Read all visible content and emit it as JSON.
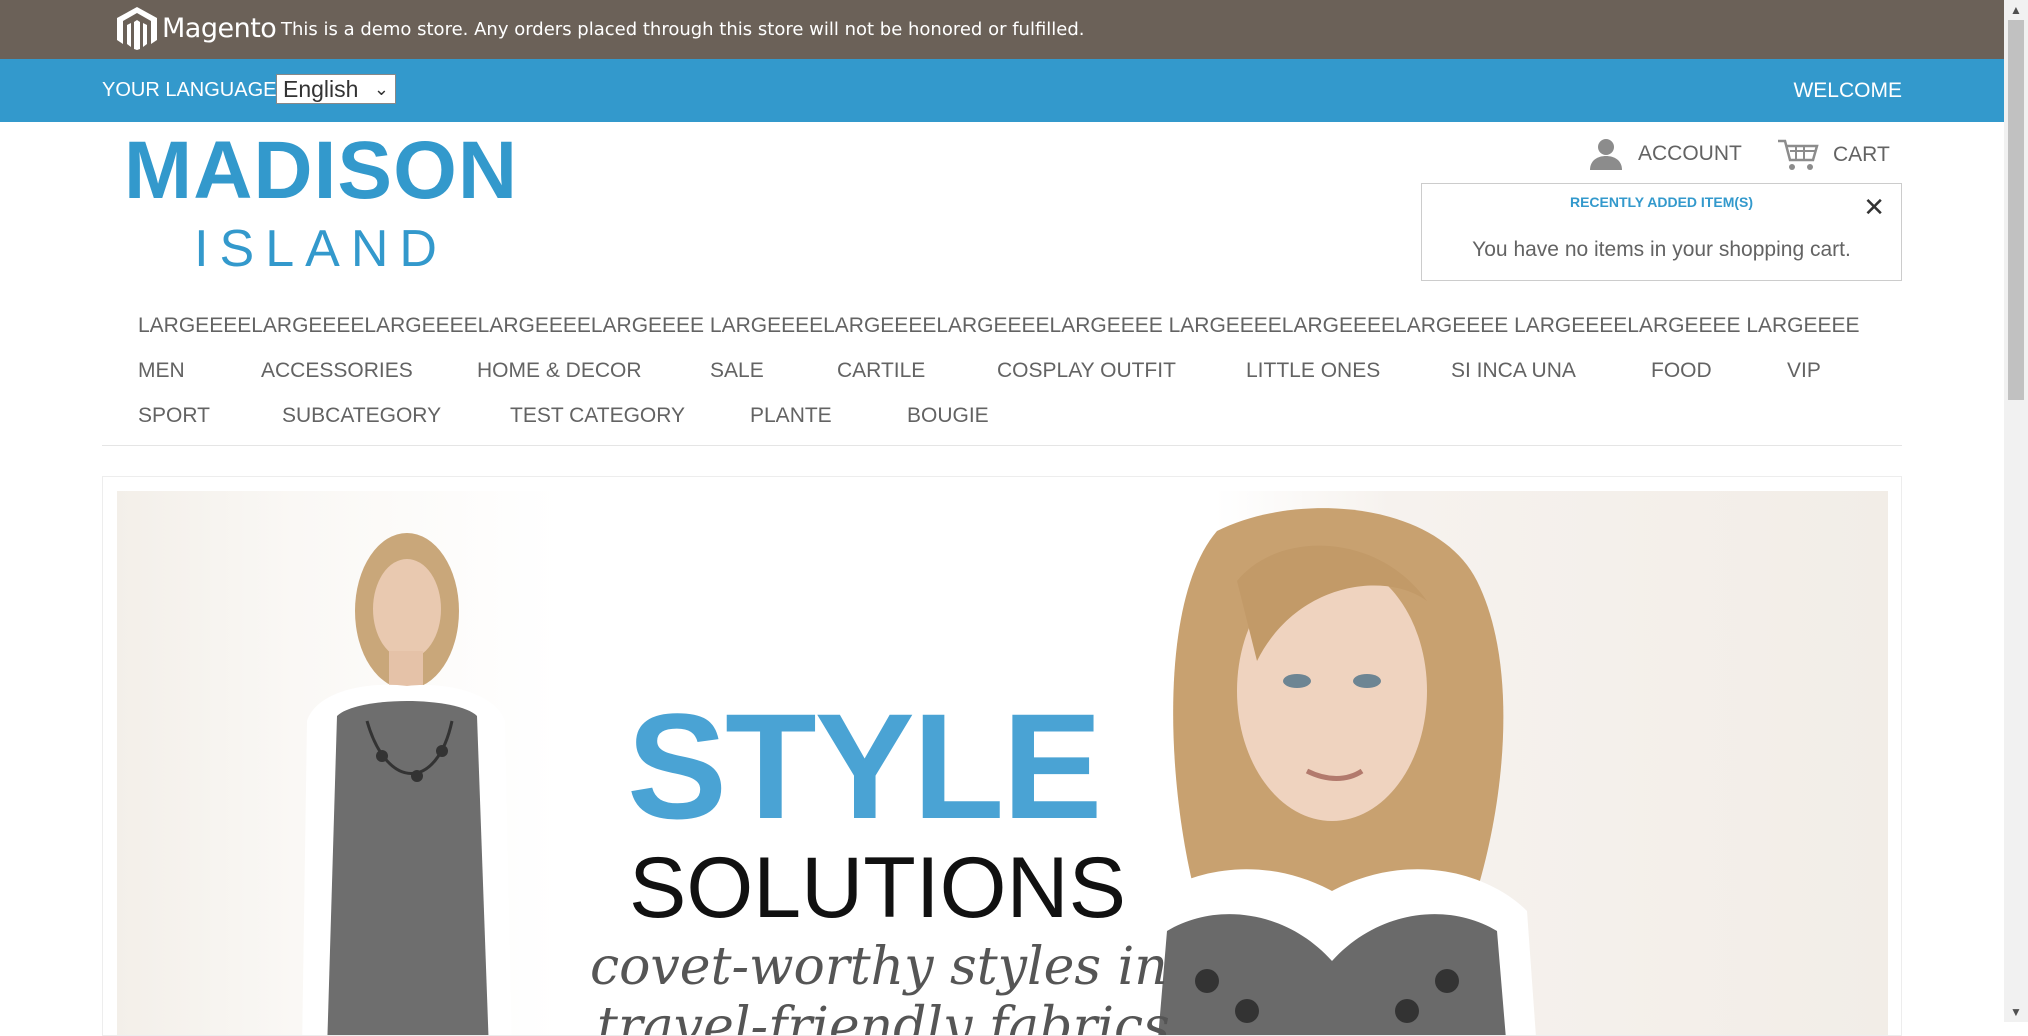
{
  "demo_bar": {
    "brand": "Magento",
    "notice": "This is a demo store. Any orders placed through this store will not be honored or fulfilled."
  },
  "top_bar": {
    "language_label": "Your Language:",
    "language_value": "English",
    "welcome": "Welcome"
  },
  "logo": {
    "line1": "MADISON",
    "line2": "ISLAND"
  },
  "header_links": {
    "account": "Account",
    "cart": "Cart"
  },
  "mini_cart": {
    "title": "Recently added item(s)",
    "empty_message": "You have no items in your shopping cart."
  },
  "nav": {
    "row1": [
      "LARGEEEELARGEEEELARGEEEELARGEEEELARGEEEE LARGEEEELARGEEEELARGEEEELARGEEEE LARGEEEELARGEEEELARGEEEE LARGEEEELARGEEEE LARGEEEE"
    ],
    "row2": [
      "Men",
      "Accessories",
      "Home & Decor",
      "Sale",
      "Cartile",
      "Cosplay outfit",
      "Little Ones",
      "si inca una",
      "Food",
      "VIP"
    ],
    "row3": [
      "Sport",
      "subcategory",
      "test category",
      "plante",
      "bougie"
    ]
  },
  "hero": {
    "headline": "STYLE",
    "subheadline": "SOLUTIONS",
    "tagline_line1": "covet-worthy styles in",
    "tagline_line2": "travel-friendly fabrics"
  },
  "colors": {
    "demo_bar_bg": "#6b6158",
    "accent_blue": "#3399cc",
    "text_gray": "#636363"
  }
}
